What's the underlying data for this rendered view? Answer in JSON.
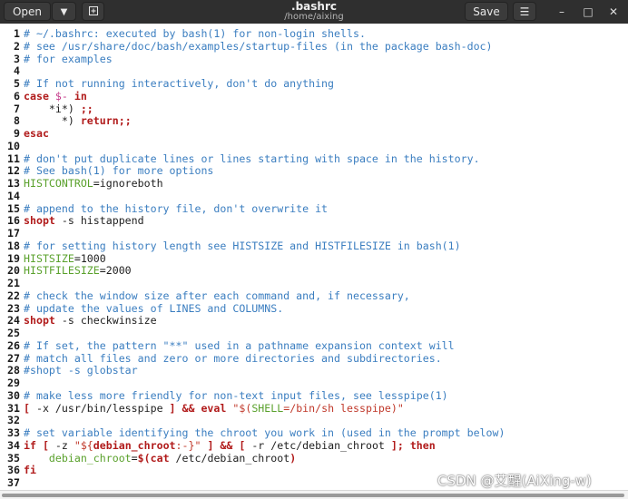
{
  "header": {
    "open_label": "Open",
    "title": ".bashrc",
    "subtitle": "/home/aixing",
    "save_label": "Save"
  },
  "watermark": "CSDN @艾醒(AiXing-w)",
  "lines": [
    {
      "n": "1",
      "segs": [
        [
          "c",
          "# ~/.bashrc: executed by bash(1) for non-login shells."
        ]
      ]
    },
    {
      "n": "2",
      "segs": [
        [
          "c",
          "# see /usr/share/doc/bash/examples/startup-files (in the package bash-doc)"
        ]
      ]
    },
    {
      "n": "3",
      "segs": [
        [
          "c",
          "# for examples"
        ]
      ]
    },
    {
      "n": "4",
      "segs": []
    },
    {
      "n": "5",
      "segs": [
        [
          "c",
          "# If not running interactively, don't do anything"
        ]
      ]
    },
    {
      "n": "6",
      "segs": [
        [
          "k",
          "case"
        ],
        [
          "",
          ""
        ],
        [
          "p",
          " $-"
        ],
        [
          "",
          " "
        ],
        [
          "k",
          "in"
        ]
      ]
    },
    {
      "n": "7",
      "segs": [
        [
          "",
          "    *i*) "
        ],
        [
          "k",
          ";;"
        ]
      ]
    },
    {
      "n": "8",
      "segs": [
        [
          "",
          "      *) "
        ],
        [
          "k",
          "return;;"
        ]
      ]
    },
    {
      "n": "9",
      "segs": [
        [
          "k",
          "esac"
        ]
      ]
    },
    {
      "n": "10",
      "segs": []
    },
    {
      "n": "11",
      "segs": [
        [
          "c",
          "# don't put duplicate lines or lines starting with space in the history."
        ]
      ]
    },
    {
      "n": "12",
      "segs": [
        [
          "c",
          "# See bash(1) for more options"
        ]
      ]
    },
    {
      "n": "13",
      "segs": [
        [
          "v",
          "HISTCONTROL"
        ],
        [
          "",
          "=ignoreboth"
        ]
      ]
    },
    {
      "n": "14",
      "segs": []
    },
    {
      "n": "15",
      "segs": [
        [
          "c",
          "# append to the history file, don't overwrite it"
        ]
      ]
    },
    {
      "n": "16",
      "segs": [
        [
          "k",
          "shopt"
        ],
        [
          "",
          " -s histappend"
        ]
      ]
    },
    {
      "n": "17",
      "segs": []
    },
    {
      "n": "18",
      "segs": [
        [
          "c",
          "# for setting history length see HISTSIZE and HISTFILESIZE in bash(1)"
        ]
      ]
    },
    {
      "n": "19",
      "segs": [
        [
          "v",
          "HISTSIZE"
        ],
        [
          "",
          "=1000"
        ]
      ]
    },
    {
      "n": "20",
      "segs": [
        [
          "v",
          "HISTFILESIZE"
        ],
        [
          "",
          "=2000"
        ]
      ]
    },
    {
      "n": "21",
      "segs": []
    },
    {
      "n": "22",
      "segs": [
        [
          "c",
          "# check the window size after each command and, if necessary,"
        ]
      ]
    },
    {
      "n": "23",
      "segs": [
        [
          "c",
          "# update the values of LINES and COLUMNS."
        ]
      ]
    },
    {
      "n": "24",
      "segs": [
        [
          "k",
          "shopt"
        ],
        [
          "",
          " -s checkwinsize"
        ]
      ]
    },
    {
      "n": "25",
      "segs": []
    },
    {
      "n": "26",
      "segs": [
        [
          "c",
          "# If set, the pattern \"**\" used in a pathname expansion context will"
        ]
      ]
    },
    {
      "n": "27",
      "segs": [
        [
          "c",
          "# match all files and zero or more directories and subdirectories."
        ]
      ]
    },
    {
      "n": "28",
      "segs": [
        [
          "c",
          "#shopt -s globstar"
        ]
      ]
    },
    {
      "n": "29",
      "segs": []
    },
    {
      "n": "30",
      "segs": [
        [
          "c",
          "# make less more friendly for non-text input files, see lesspipe(1)"
        ]
      ]
    },
    {
      "n": "31",
      "segs": [
        [
          "k",
          "["
        ],
        [
          "",
          " -x /usr/bin/lesspipe "
        ],
        [
          "k",
          "]"
        ],
        [
          "",
          " "
        ],
        [
          "k",
          "&& eval"
        ],
        [
          "",
          " "
        ],
        [
          "s",
          "\"$("
        ],
        [
          "v",
          "SHELL"
        ],
        [
          "s",
          "=/bin/sh lesspipe)\""
        ]
      ]
    },
    {
      "n": "32",
      "segs": []
    },
    {
      "n": "33",
      "segs": [
        [
          "c",
          "# set variable identifying the chroot you work in (used in the prompt below)"
        ]
      ]
    },
    {
      "n": "34",
      "segs": [
        [
          "k",
          "if ["
        ],
        [
          "",
          " -z "
        ],
        [
          "s",
          "\"${"
        ],
        [
          "k",
          "debian_chroot"
        ],
        [
          "s",
          ":-}\""
        ],
        [
          "",
          " "
        ],
        [
          "k",
          "] && ["
        ],
        [
          "",
          " -r /etc/debian_chroot "
        ],
        [
          "k",
          "]; then"
        ]
      ]
    },
    {
      "n": "35",
      "segs": [
        [
          "",
          "    "
        ],
        [
          "v",
          "debian_chroot"
        ],
        [
          "",
          "="
        ],
        [
          "k",
          "$("
        ],
        [
          "k",
          "cat"
        ],
        [
          "",
          " /etc/debian_chroot"
        ],
        [
          "k",
          ")"
        ]
      ]
    },
    {
      "n": "36",
      "segs": [
        [
          "k",
          "fi"
        ]
      ]
    },
    {
      "n": "37",
      "segs": []
    }
  ]
}
